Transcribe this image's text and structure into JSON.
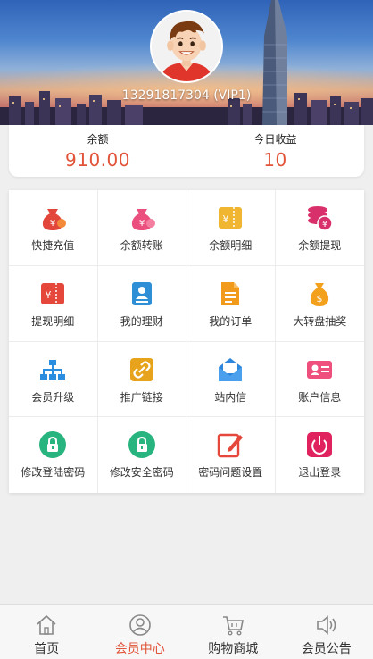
{
  "header": {
    "phone": "13291817304 (VIP1)"
  },
  "balance": {
    "balance_label": "余额",
    "balance_value": "910.00",
    "today_label": "今日收益",
    "today_value": "10",
    "accent_color": "#e2543a"
  },
  "menu": {
    "items": [
      {
        "label": "快捷充值",
        "icon": "money-bag-red-icon"
      },
      {
        "label": "余额转账",
        "icon": "money-bag-pink-icon"
      },
      {
        "label": "余额明细",
        "icon": "yen-ticket-icon"
      },
      {
        "label": "余额提现",
        "icon": "coins-yen-icon"
      },
      {
        "label": "提现明细",
        "icon": "yen-ticket-red-icon"
      },
      {
        "label": "我的理财",
        "icon": "profile-card-icon"
      },
      {
        "label": "我的订单",
        "icon": "document-icon"
      },
      {
        "label": "大转盘抽奖",
        "icon": "dollar-bag-icon"
      },
      {
        "label": "会员升级",
        "icon": "org-chart-icon"
      },
      {
        "label": "推广链接",
        "icon": "link-icon"
      },
      {
        "label": "站内信",
        "icon": "envelope-icon"
      },
      {
        "label": "账户信息",
        "icon": "id-card-icon"
      },
      {
        "label": "修改登陆密码",
        "icon": "lock-icon"
      },
      {
        "label": "修改安全密码",
        "icon": "lock-icon"
      },
      {
        "label": "密码问题设置",
        "icon": "edit-icon"
      },
      {
        "label": "退出登录",
        "icon": "power-icon"
      }
    ]
  },
  "tabbar": {
    "tabs": [
      {
        "label": "首页",
        "icon": "home-icon"
      },
      {
        "label": "会员中心",
        "icon": "user-icon",
        "active": true
      },
      {
        "label": "购物商城",
        "icon": "cart-icon"
      },
      {
        "label": "会员公告",
        "icon": "speaker-icon"
      }
    ]
  }
}
